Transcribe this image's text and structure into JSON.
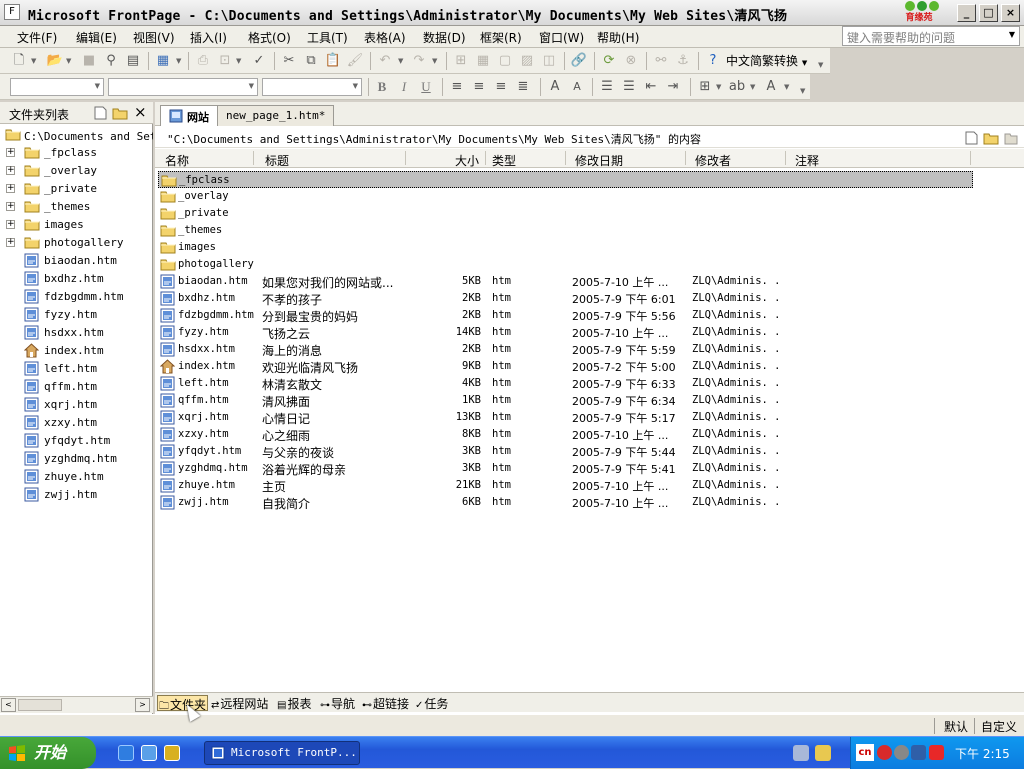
{
  "window": {
    "title": "Microsoft FrontPage - C:\\Documents and Settings\\Administrator\\My Documents\\My Web Sites\\清风飞扬",
    "buttons": {
      "minimize": "_",
      "maximize": "□",
      "close": "×"
    }
  },
  "brand_logo_text": "育缘苑",
  "menu": {
    "items": [
      "文件(F)",
      "编辑(E)",
      "视图(V)",
      "插入(I)",
      "格式(O)",
      "工具(T)",
      "表格(A)",
      "数据(D)",
      "框架(R)",
      "窗口(W)",
      "帮助(H)"
    ],
    "help_placeholder": "键入需要帮助的问题"
  },
  "toolbar": {
    "cn_convert_label": "中文简繁转换",
    "format_buttons": {
      "bold": "B",
      "italic": "I",
      "underline": "U"
    }
  },
  "folder_panel": {
    "header": "文件夹列表",
    "close_label": "×",
    "root": "C:\\Documents and Settings\\Administrator\\My Documents\\My Web Sites\\清风飞扬",
    "folders": [
      "_fpclass",
      "_overlay",
      "_private",
      "_themes",
      "images",
      "photogallery"
    ],
    "files": [
      "biaodan.htm",
      "bxdhz.htm",
      "fdzbgdmm.htm",
      "fyzy.htm",
      "hsdxx.htm",
      "index.htm",
      "left.htm",
      "qffm.htm",
      "xqrj.htm",
      "xzxy.htm",
      "yfqdyt.htm",
      "yzghdmq.htm",
      "zhuye.htm",
      "zwjj.htm"
    ],
    "home_file": "index.htm",
    "scroll_left": "<",
    "scroll_right": ">"
  },
  "tabs": [
    {
      "label": "网站",
      "active": true
    },
    {
      "label": "new_page_1.htm*",
      "active": false
    }
  ],
  "path_bar": "\"C:\\Documents and Settings\\Administrator\\My Documents\\My Web Sites\\清风飞扬\" 的内容",
  "columns": [
    "名称",
    "标题",
    "大小",
    "类型",
    "修改日期",
    "修改者",
    "注释"
  ],
  "rows": [
    {
      "name": "_fpclass",
      "kind": "folder",
      "title": "",
      "size": "",
      "type": "",
      "date": "",
      "modifier": "",
      "selected": true
    },
    {
      "name": "_overlay",
      "kind": "folder",
      "title": "",
      "size": "",
      "type": "",
      "date": "",
      "modifier": ""
    },
    {
      "name": "_private",
      "kind": "folder",
      "title": "",
      "size": "",
      "type": "",
      "date": "",
      "modifier": ""
    },
    {
      "name": "_themes",
      "kind": "folder",
      "title": "",
      "size": "",
      "type": "",
      "date": "",
      "modifier": ""
    },
    {
      "name": "images",
      "kind": "folder",
      "title": "",
      "size": "",
      "type": "",
      "date": "",
      "modifier": ""
    },
    {
      "name": "photogallery",
      "kind": "folder",
      "title": "",
      "size": "",
      "type": "",
      "date": "",
      "modifier": ""
    },
    {
      "name": "biaodan.htm",
      "kind": "page",
      "title": "如果您对我们的网站或...",
      "size": "5KB",
      "type": "htm",
      "date": "2005-7-10 上午 ...",
      "modifier": "ZLQ\\Adminis. ."
    },
    {
      "name": "bxdhz.htm",
      "kind": "page",
      "title": "不孝的孩子",
      "size": "2KB",
      "type": "htm",
      "date": "2005-7-9 下午 6:01",
      "modifier": "ZLQ\\Adminis. ."
    },
    {
      "name": "fdzbgdmm.htm",
      "kind": "page",
      "title": "分到最宝贵的妈妈",
      "size": "2KB",
      "type": "htm",
      "date": "2005-7-9 下午 5:56",
      "modifier": "ZLQ\\Adminis. ."
    },
    {
      "name": "fyzy.htm",
      "kind": "page",
      "title": "飞扬之云",
      "size": "14KB",
      "type": "htm",
      "date": "2005-7-10 上午 ...",
      "modifier": "ZLQ\\Adminis. ."
    },
    {
      "name": "hsdxx.htm",
      "kind": "page",
      "title": "海上的消息",
      "size": "2KB",
      "type": "htm",
      "date": "2005-7-9 下午 5:59",
      "modifier": "ZLQ\\Adminis. ."
    },
    {
      "name": "index.htm",
      "kind": "home",
      "title": "欢迎光临清风飞扬",
      "size": "9KB",
      "type": "htm",
      "date": "2005-7-2 下午 5:00",
      "modifier": "ZLQ\\Adminis. ."
    },
    {
      "name": "left.htm",
      "kind": "page",
      "title": "林清玄散文",
      "size": "4KB",
      "type": "htm",
      "date": "2005-7-9 下午 6:33",
      "modifier": "ZLQ\\Adminis. ."
    },
    {
      "name": "qffm.htm",
      "kind": "page",
      "title": "清风拂面",
      "size": "1KB",
      "type": "htm",
      "date": "2005-7-9 下午 6:34",
      "modifier": "ZLQ\\Adminis. ."
    },
    {
      "name": "xqrj.htm",
      "kind": "page",
      "title": "心情日记",
      "size": "13KB",
      "type": "htm",
      "date": "2005-7-9 下午 5:17",
      "modifier": "ZLQ\\Adminis. ."
    },
    {
      "name": "xzxy.htm",
      "kind": "page",
      "title": "心之细雨",
      "size": "8KB",
      "type": "htm",
      "date": "2005-7-10 上午 ...",
      "modifier": "ZLQ\\Adminis. ."
    },
    {
      "name": "yfqdyt.htm",
      "kind": "page",
      "title": "与父亲的夜谈",
      "size": "3KB",
      "type": "htm",
      "date": "2005-7-9 下午 5:44",
      "modifier": "ZLQ\\Adminis. ."
    },
    {
      "name": "yzghdmq.htm",
      "kind": "page",
      "title": "浴着光辉的母亲",
      "size": "3KB",
      "type": "htm",
      "date": "2005-7-9 下午 5:41",
      "modifier": "ZLQ\\Adminis. ."
    },
    {
      "name": "zhuye.htm",
      "kind": "page",
      "title": "主页",
      "size": "21KB",
      "type": "htm",
      "date": "2005-7-10 上午 ...",
      "modifier": "ZLQ\\Adminis. ."
    },
    {
      "name": "zwjj.htm",
      "kind": "page",
      "title": "自我简介",
      "size": "6KB",
      "type": "htm",
      "date": "2005-7-10 上午 ...",
      "modifier": "ZLQ\\Adminis. ."
    }
  ],
  "views": [
    {
      "label": "文件夹",
      "active": true
    },
    {
      "label": "远程网站",
      "active": false
    },
    {
      "label": "报表",
      "active": false
    },
    {
      "label": "导航",
      "active": false
    },
    {
      "label": "超链接",
      "active": false
    },
    {
      "label": "任务",
      "active": false
    }
  ],
  "status": {
    "mode": "默认",
    "custom": "自定义"
  },
  "taskbar": {
    "start_label": "开始",
    "task_label": "Microsoft FrontP...",
    "clock": "下午 2:15",
    "ime": "cn"
  },
  "colors": {
    "taskbar_blue": "#2358d8",
    "start_green": "#3c9c30",
    "selection_gray": "#c0c0c0",
    "folder_yellow": "#f3d36b",
    "tray_blue": "#0f98ef"
  }
}
